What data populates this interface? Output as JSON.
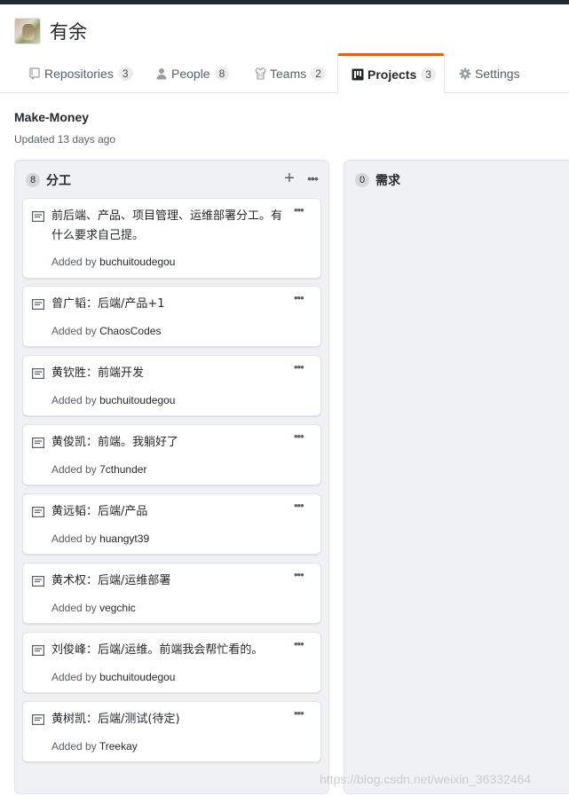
{
  "org": {
    "name": "有余"
  },
  "tabs": [
    {
      "label": "Repositories",
      "count": "3"
    },
    {
      "label": "People",
      "count": "8"
    },
    {
      "label": "Teams",
      "count": "2"
    },
    {
      "label": "Projects",
      "count": "3"
    },
    {
      "label": "Settings",
      "count": ""
    }
  ],
  "project": {
    "title": "Make-Money",
    "updated": "Updated 13 days ago"
  },
  "columns": [
    {
      "name": "分工",
      "count": "8",
      "cards": [
        {
          "text": "前后端、产品、项目管理、运维部署分工。有什么要求自己提。",
          "added_by_label": "Added by",
          "author": "buchuitoudegou"
        },
        {
          "text": "曾广韬：后端/产品+1",
          "added_by_label": "Added by",
          "author": "ChaosCodes"
        },
        {
          "text": "黄钦胜：前端开发",
          "added_by_label": "Added by",
          "author": "buchuitoudegou"
        },
        {
          "text": "黄俊凯：前端。我躺好了",
          "added_by_label": "Added by",
          "author": "7cthunder"
        },
        {
          "text": "黄远韬：后端/产品",
          "added_by_label": "Added by",
          "author": "huangyt39"
        },
        {
          "text": "黄术权：后端/运维部署",
          "added_by_label": "Added by",
          "author": "vegchic"
        },
        {
          "text": "刘俊峰：后端/运维。前端我会帮忙看的。",
          "added_by_label": "Added by",
          "author": "buchuitoudegou"
        },
        {
          "text": "黄树凯：后端/测试(待定)",
          "added_by_label": "Added by",
          "author": "Treekay"
        }
      ]
    },
    {
      "name": "需求",
      "count": "0",
      "cards": []
    }
  ],
  "watermark": "https://blog.csdn.net/weixin_36332464",
  "icons": {
    "add": "plus-icon",
    "more": "kebab-horizontal-icon",
    "note": "note-icon"
  },
  "colors": {
    "selected_tab_accent": "#e36209",
    "column_bg": "#eff1f3"
  }
}
